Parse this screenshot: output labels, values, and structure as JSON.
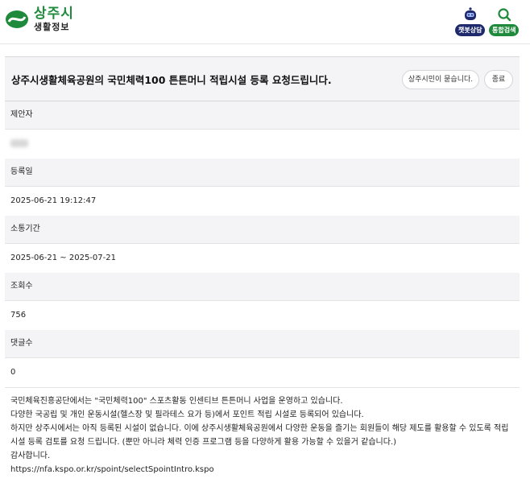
{
  "brand": {
    "title": "상주시",
    "subtitle": "생활정보",
    "accent": "#1f8a3b"
  },
  "header": {
    "chatbot_label": "챗봇상담",
    "search_label": "통합검색",
    "chatbot_color": "#1e2a6b"
  },
  "post": {
    "title": "상주시생활체육공원의 국민체력100 튼튼머니 적립시설 등록 요청드립니다.",
    "ask_button": "상주시민이 묻습니다.",
    "close_button": "종료",
    "fields": [
      {
        "label": "제안자",
        "value": ""
      },
      {
        "label": "등록일",
        "value": "2025-06-21 19:12:47"
      },
      {
        "label": "소통기간",
        "value": "2025-06-21 ~ 2025-07-21"
      },
      {
        "label": "조회수",
        "value": "756"
      },
      {
        "label": "댓글수",
        "value": "0"
      }
    ],
    "content": [
      "국민체육진흥공단에서는 \"국민체력100\" 스포츠활동 인센티브 튼튼머니 사업을 운영하고 있습니다.",
      "다양한 국공립 및 개인 운동시설(헬스장 및 필라테스 요가 등)에서 포인트 적립 시설로 등록되어 있습니다.",
      "하지만 상주시에서는 아직 등록된 시설이 없습니다. 이에 상주시생활체육공원에서 다양한 운동을 즐기는 회원들이 해당 제도를 활용할 수 있도록 적립시설 등록 검토를 요청 드립니다. (뿐만 아니라 체력 인증 프로그램 등을 다양하게 활용 가능할 수 있을거 같습니다.)",
      "감사합니다."
    ],
    "link": "https://nfa.kspo.or.kr/spoint/selectSpointIntro.kspo"
  }
}
